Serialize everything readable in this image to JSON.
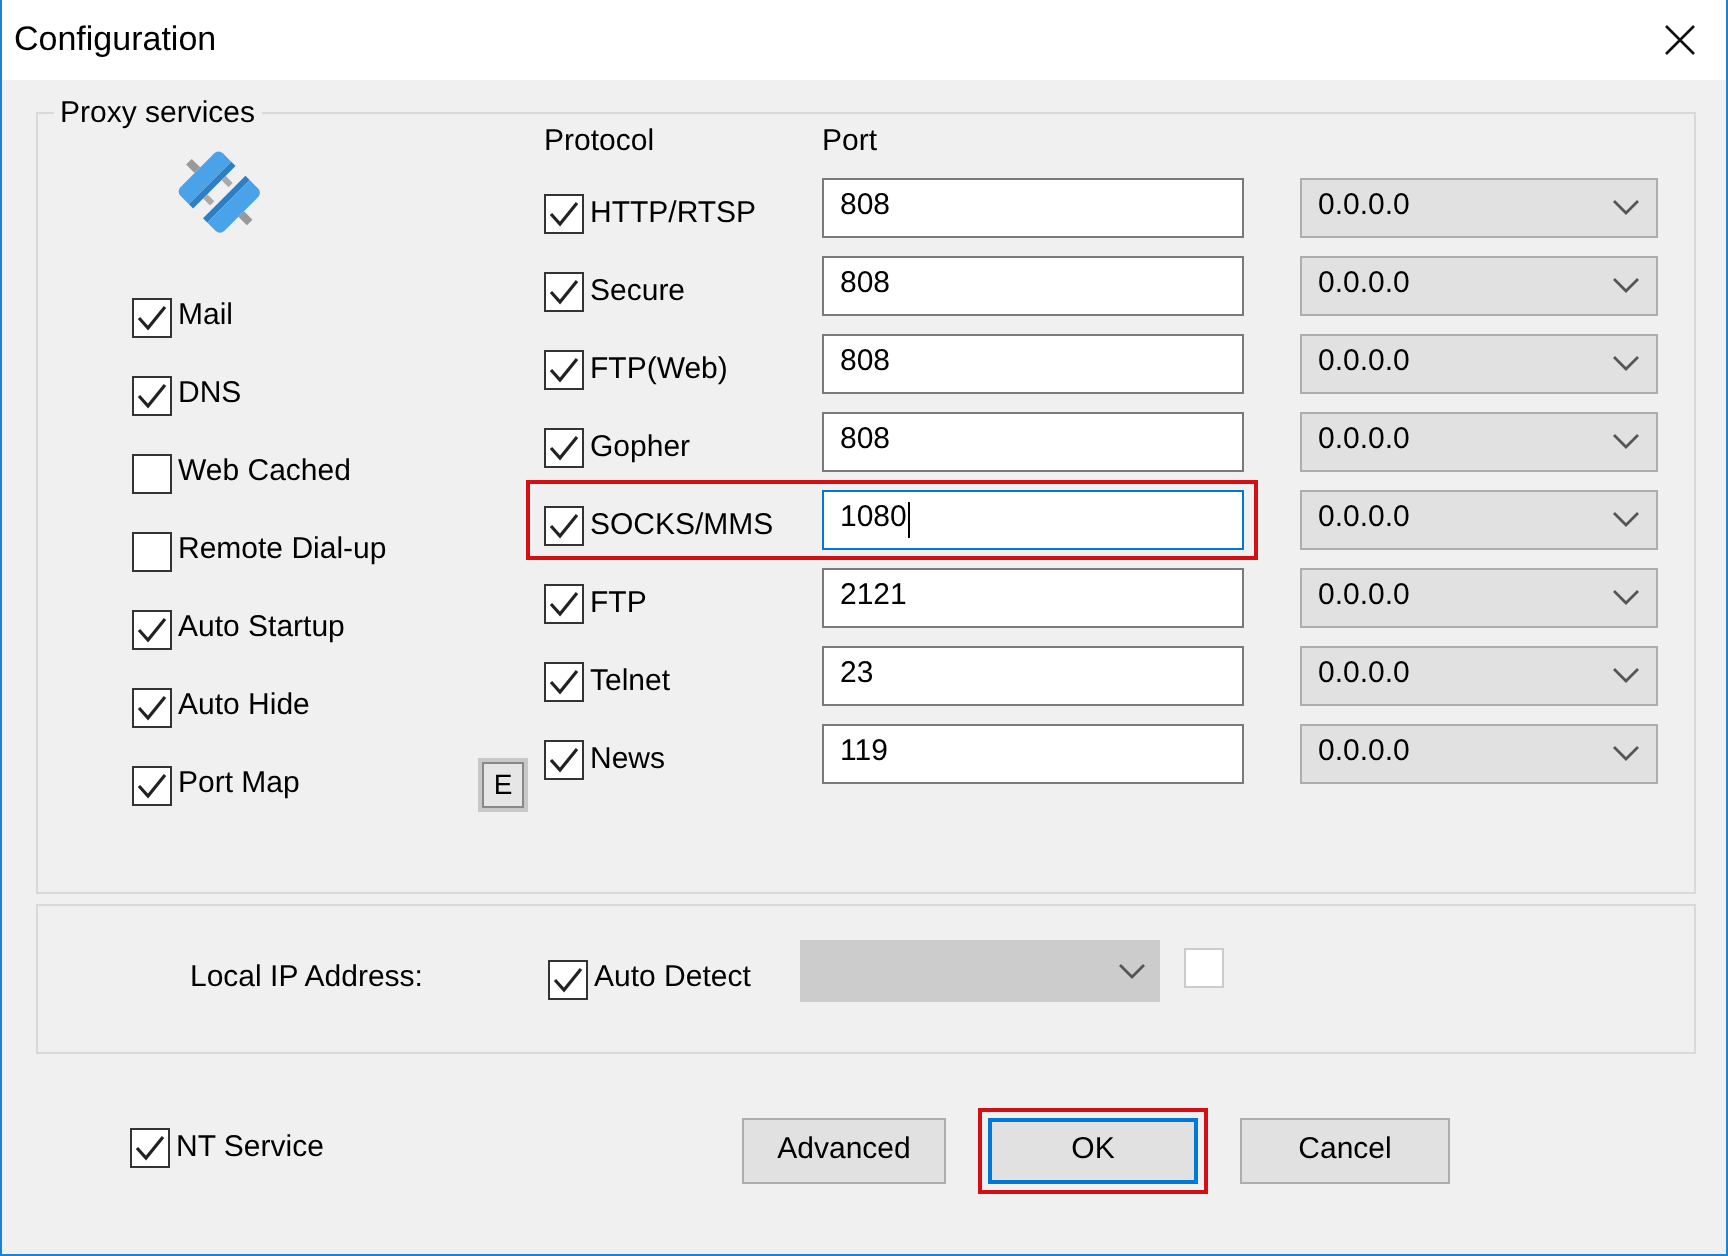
{
  "window": {
    "title": "Configuration"
  },
  "proxy_services": {
    "title": "Proxy services",
    "services": [
      {
        "label": "Mail",
        "checked": true
      },
      {
        "label": "DNS",
        "checked": true
      },
      {
        "label": "Web Cached",
        "checked": false
      },
      {
        "label": "Remote Dial-up",
        "checked": false
      },
      {
        "label": "Auto Startup",
        "checked": true
      },
      {
        "label": "Auto Hide",
        "checked": true
      },
      {
        "label": "Port Map",
        "checked": true
      }
    ],
    "port_map_button": "E"
  },
  "protocols": {
    "heading_protocol": "Protocol",
    "heading_port": "Port",
    "rows": [
      {
        "label": "HTTP/RTSP",
        "checked": true,
        "port": "808",
        "address": "0.0.0.0",
        "focused": false,
        "highlighted": false
      },
      {
        "label": "Secure",
        "checked": true,
        "port": "808",
        "address": "0.0.0.0",
        "focused": false,
        "highlighted": false
      },
      {
        "label": "FTP(Web)",
        "checked": true,
        "port": "808",
        "address": "0.0.0.0",
        "focused": false,
        "highlighted": false
      },
      {
        "label": "Gopher",
        "checked": true,
        "port": "808",
        "address": "0.0.0.0",
        "focused": false,
        "highlighted": false
      },
      {
        "label": "SOCKS/MMS",
        "checked": true,
        "port": "1080",
        "address": "0.0.0.0",
        "focused": true,
        "highlighted": true
      },
      {
        "label": "FTP",
        "checked": true,
        "port": "2121",
        "address": "0.0.0.0",
        "focused": false,
        "highlighted": false
      },
      {
        "label": "Telnet",
        "checked": true,
        "port": "23",
        "address": "0.0.0.0",
        "focused": false,
        "highlighted": false
      },
      {
        "label": "News",
        "checked": true,
        "port": "119",
        "address": "0.0.0.0",
        "focused": false,
        "highlighted": false
      }
    ]
  },
  "local_ip": {
    "label": "Local IP Address:",
    "auto_detect": {
      "label": "Auto Detect",
      "checked": true
    },
    "address_disabled": true,
    "extra_checkbox": {
      "checked": false
    }
  },
  "nt_service": {
    "label": "NT Service",
    "checked": true
  },
  "buttons": [
    {
      "label": "Advanced",
      "default": false,
      "highlighted": false
    },
    {
      "label": "OK",
      "default": true,
      "highlighted": true
    },
    {
      "label": "Cancel",
      "default": false,
      "highlighted": false
    }
  ]
}
